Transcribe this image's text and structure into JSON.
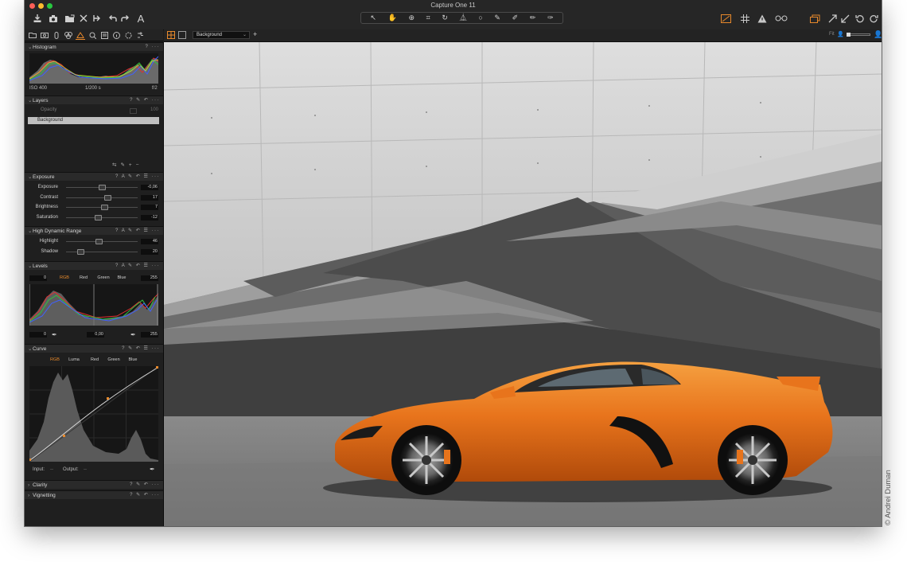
{
  "window": {
    "title": "Capture One 11"
  },
  "colors": {
    "accent": "#e8892b",
    "panel": "#1f1f1f",
    "close": "#fc5f57",
    "minimize": "#fdbb2e",
    "zoom": "#28c840"
  },
  "toolbar_left_icons": [
    "import-icon",
    "camera-icon",
    "folder-icon",
    "delete-icon",
    "rotate-icon",
    "undo-icon",
    "redo-icon",
    "text-icon"
  ],
  "toolbar_center_icons": [
    "select-icon",
    "pan-icon",
    "zoom-icon",
    "crop-icon",
    "rotate-icon",
    "keystone-icon",
    "spot-icon",
    "brush-icon",
    "eraser-icon",
    "gradient-icon",
    "picker-icon"
  ],
  "toolbar_right_icons": [
    "exposure-warning-icon",
    "grid-icon",
    "warning-icon",
    "glasses-icon",
    "stack-icon",
    "expand-icon",
    "reset-icon",
    "redo-icon"
  ],
  "viewer_bar": {
    "layer_select": "Background",
    "add_label": "+",
    "fit_label": "Fit"
  },
  "histogram": {
    "title": "Histogram",
    "iso": "ISO 400",
    "shutter": "1/200 s",
    "aperture": "f/2"
  },
  "layers": {
    "title": "Layers",
    "opacity_label": "Opacity",
    "opacity_value": "100",
    "items": [
      "Background"
    ]
  },
  "exposure": {
    "title": "Exposure",
    "rows": [
      {
        "label": "Exposure",
        "value": "-0,06",
        "pos": 0.5
      },
      {
        "label": "Contrast",
        "value": "17",
        "pos": 0.58
      },
      {
        "label": "Brightness",
        "value": "7",
        "pos": 0.53
      },
      {
        "label": "Saturation",
        "value": "-12",
        "pos": 0.44
      }
    ]
  },
  "hdr": {
    "title": "High Dynamic Range",
    "rows": [
      {
        "label": "Highlight",
        "value": "46",
        "pos": 0.46
      },
      {
        "label": "Shadow",
        "value": "20",
        "pos": 0.2
      }
    ]
  },
  "levels": {
    "title": "Levels",
    "black_in": "0",
    "white_in": "255",
    "black_out": "0",
    "mid": "0,00",
    "white_out": "255",
    "channels": [
      "RGB",
      "Red",
      "Green",
      "Blue"
    ]
  },
  "curve": {
    "title": "Curve",
    "channels": [
      "RGB",
      "Luma",
      "Red",
      "Green",
      "Blue"
    ],
    "input_label": "Input:",
    "input_value": "--",
    "output_label": "Output:",
    "output_value": "--"
  },
  "collapsed": [
    {
      "title": "Clarity"
    },
    {
      "title": "Vignetting"
    }
  ],
  "credit": "© Andrei Duman"
}
